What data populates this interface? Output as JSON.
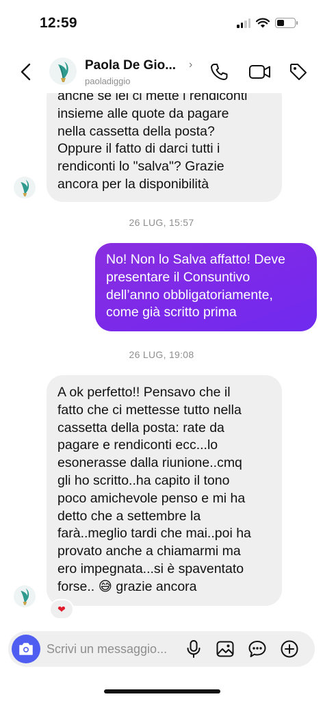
{
  "status_bar": {
    "time": "12:59",
    "battery_level": 0.42
  },
  "header": {
    "name": "Paola De Gio...",
    "chevron": "›",
    "username": "paoladiggio",
    "icons": [
      "back-arrow-icon",
      "phone-icon",
      "video-camera-icon",
      "tag-icon"
    ]
  },
  "messages": [
    {
      "direction": "incoming",
      "lines": [
        "anche se lei ci mette i rendiconti",
        "insieme alle quote da pagare",
        "nella cassetta della posta?",
        "Oppure il fatto di darci tutti i",
        "rendiconti lo \"salva\"? Grazie",
        "ancora per la disponibilità"
      ]
    },
    {
      "timestamp": "26 LUG, 15:57"
    },
    {
      "direction": "outgoing",
      "lines": [
        "No! Non lo Salva affatto! Deve",
        "presentare il Consuntivo",
        "dell’anno obbligatoriamente,",
        "come già scritto prima"
      ]
    },
    {
      "timestamp": "26 LUG, 19:08"
    },
    {
      "direction": "incoming",
      "lines": [
        "A ok perfetto!! Pensavo che il",
        "fatto che ci mettesse tutto nella",
        "cassetta della posta: rate da",
        "pagare e rendiconti ecc...lo",
        "esonerasse dalla riunione..cmq",
        "gli ho scritto..ha capito il tono",
        "poco amichevole penso e mi ha",
        "detto che a settembre la",
        "farà..meglio tardi che mai..poi ha",
        "provato anche a chiamarmi ma",
        "ero impegnata...si è spaventato",
        "forse.. 😅 grazie ancora"
      ],
      "reaction": "❤"
    }
  ],
  "composer": {
    "placeholder": "Scrivi un messaggio...",
    "icons": [
      "camera-icon",
      "microphone-icon",
      "gallery-icon",
      "sticker-icon",
      "plus-icon"
    ]
  },
  "colors": {
    "outgoing_bubble": "#7a29ea",
    "incoming_bubble": "#efefef",
    "camera_button": "#4f5df0",
    "timestamp_text": "#8e8e8e"
  }
}
